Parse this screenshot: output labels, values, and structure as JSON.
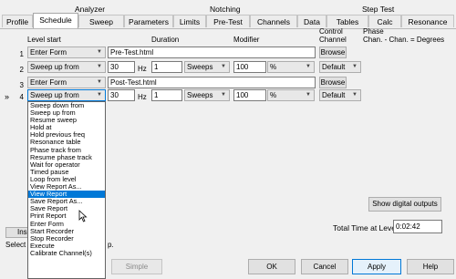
{
  "groups": [
    "Analyzer",
    "Notching",
    "Step Test"
  ],
  "tabs": [
    "Profile",
    "Schedule",
    "Sweep",
    "Parameters",
    "Limits",
    "Pre-Test",
    "Channels",
    "Data",
    "Tables",
    "Calc",
    "Resonance"
  ],
  "active_tab": "Schedule",
  "headers": {
    "level_start": "Level start",
    "duration": "Duration",
    "modifier": "Modifier",
    "control_channel": "Control\nChannel",
    "phase": "Phase\nChan. - Chan. = Degrees"
  },
  "rows": [
    {
      "num": "1",
      "level": "Enter Form",
      "file": "Pre-Test.html",
      "action": "Browse"
    },
    {
      "num": "2",
      "level": "Sweep up from",
      "freq": "30",
      "freq_unit": "Hz",
      "count": "1",
      "count_unit": "Sweeps",
      "mod": "100",
      "mod_unit": "%",
      "channel": "Default"
    },
    {
      "num": "3",
      "level": "Enter Form",
      "file": "Post-Test.html",
      "action": "Browse"
    },
    {
      "num": "4",
      "marker": "»",
      "level": "Sweep up from",
      "freq": "30",
      "freq_unit": "Hz",
      "count": "1",
      "count_unit": "Sweeps",
      "mod": "100",
      "mod_unit": "%",
      "channel": "Default"
    }
  ],
  "dropdown": {
    "items": [
      "Sweep down from",
      "Sweep up from",
      "Resume sweep",
      "Hold at",
      "Hold previous freq",
      "Resonance table",
      "Phase track from",
      "Resume phase track",
      "Wait for operator",
      "Timed pause",
      "Loop from level",
      "View Report As...",
      "View Report",
      "Save Report As...",
      "Save Report",
      "Print Report",
      "Enter Form",
      "Start Recorder",
      "Stop Recorder",
      "Execute",
      "Calibrate Channel(s)"
    ],
    "selected": "View Report"
  },
  "show_digital_outputs": "Show digital outputs",
  "total_time_label": "Total Time at Level",
  "total_time_value": "0:02:42",
  "obscured": {
    "insert_partial": "Inse",
    "select_partial": "Select",
    "select_tail": "p."
  },
  "buttons": {
    "simple": "Simple",
    "ok": "OK",
    "cancel": "Cancel",
    "apply": "Apply",
    "help": "Help"
  }
}
